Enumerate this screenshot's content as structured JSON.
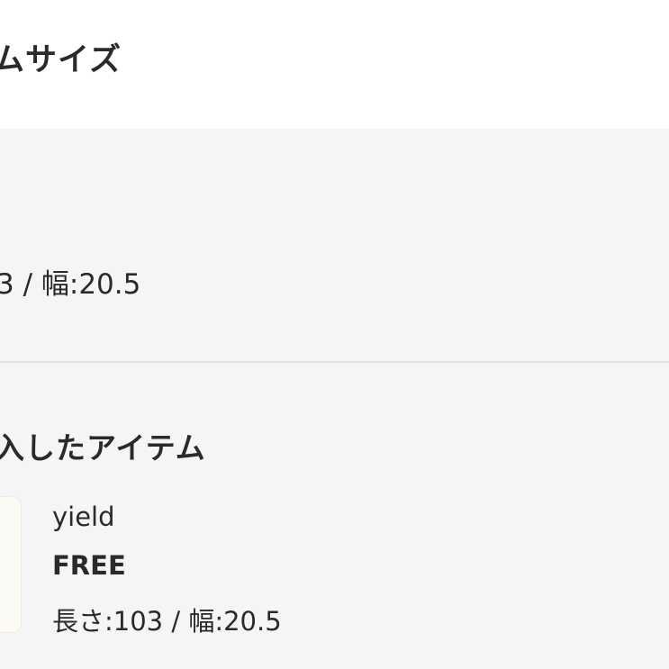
{
  "header": {
    "title": "ムサイズ"
  },
  "size_section": {
    "value": "3 / 幅:20.5"
  },
  "purchased": {
    "title": "入したアイテム",
    "item": {
      "brand": "yield",
      "size": "FREE",
      "measurements": "長さ:103 / 幅:20.5"
    }
  }
}
